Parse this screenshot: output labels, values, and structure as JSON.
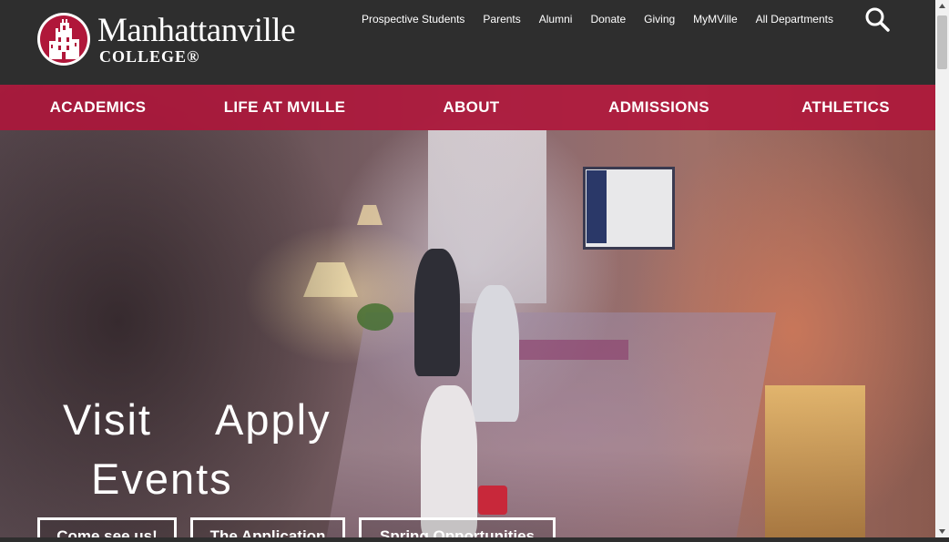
{
  "brand": {
    "name": "Manhattanville",
    "college": "COLLEGE®",
    "colors": {
      "crimson": "#b0173a",
      "header_bg": "#2e2e2e"
    }
  },
  "utility_nav": [
    "Prospective Students",
    "Parents",
    "Alumni",
    "Donate",
    "Giving",
    "MyMVille",
    "All Departments"
  ],
  "search": {
    "icon": "search-icon"
  },
  "main_nav": [
    "ACADEMICS",
    "LIFE AT MVILLE",
    "ABOUT",
    "ADMISSIONS",
    "ATHLETICS"
  ],
  "hero": {
    "headline_words": [
      "Visit",
      "Apply",
      "Events"
    ],
    "buttons": [
      "Come see us!",
      "The Application",
      "Spring Opportunities"
    ]
  }
}
